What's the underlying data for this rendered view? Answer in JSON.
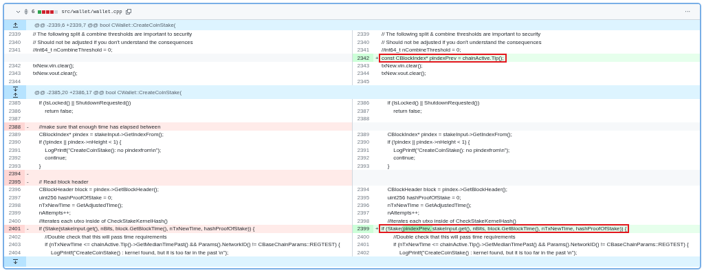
{
  "file_header": {
    "changes": "6",
    "diffstat": [
      {
        "color": "#2da44e"
      },
      {
        "color": "#cf222e"
      },
      {
        "color": "#cf222e"
      },
      {
        "color": "#cf222e"
      },
      {
        "color": "#d0d7de"
      }
    ],
    "path": "src/wallet/wallet.cpp",
    "menu": "···"
  },
  "hunks": [
    {
      "header": "@@ -2339,6 +2339,7 @@ bool CWallet::CreateCoinStake(",
      "expand_down": false,
      "rows": [
        {
          "left": {
            "kind": "context",
            "number": "2339",
            "code": "// The following split & combine thresholds are important to security"
          },
          "right": {
            "kind": "context",
            "number": "2339",
            "code": "// The following split & combine thresholds are important to security"
          }
        },
        {
          "left": {
            "kind": "context",
            "number": "2340",
            "code": "// Should not be adjusted if you don't understand the consequences"
          },
          "right": {
            "kind": "context",
            "number": "2340",
            "code": "// Should not be adjusted if you don't understand the consequences"
          }
        },
        {
          "left": {
            "kind": "context",
            "number": "2341",
            "code": "//int64_t nCombineThreshold = 0;"
          },
          "right": {
            "kind": "context",
            "number": "2341",
            "code": "//int64_t nCombineThreshold = 0;"
          }
        },
        {
          "left": {
            "kind": "empty"
          },
          "right": {
            "kind": "added",
            "number": "2342",
            "sign": "+",
            "boxed": true,
            "code": "const CBlockIndex* pindexPrev = chainActive.Tip();"
          }
        },
        {
          "left": {
            "kind": "context",
            "number": "2342",
            "code": "txNew.vin.clear();"
          },
          "right": {
            "kind": "context",
            "number": "2343",
            "code": "txNew.vin.clear();"
          }
        },
        {
          "left": {
            "kind": "context",
            "number": "2343",
            "code": "txNew.vout.clear();"
          },
          "right": {
            "kind": "context",
            "number": "2344",
            "code": "txNew.vout.clear();"
          }
        },
        {
          "left": {
            "kind": "context",
            "number": "2344"
          },
          "right": {
            "kind": "context",
            "number": "2345"
          }
        }
      ]
    },
    {
      "header": "@@ -2385,20 +2386,17 @@ bool CWallet::CreateCoinStake(",
      "expand_down": true,
      "rows": [
        {
          "left": {
            "kind": "context",
            "number": "2385",
            "code": "    if (IsLocked() || ShutdownRequested())"
          },
          "right": {
            "kind": "context",
            "number": "2386",
            "code": "    if (IsLocked() || ShutdownRequested())"
          }
        },
        {
          "left": {
            "kind": "context",
            "number": "2386",
            "code": "        return false;"
          },
          "right": {
            "kind": "context",
            "number": "2387",
            "code": "        return false;"
          }
        },
        {
          "left": {
            "kind": "context",
            "number": "2387"
          },
          "right": {
            "kind": "context",
            "number": "2388"
          }
        },
        {
          "left": {
            "kind": "deleted",
            "number": "2388",
            "sign": "-",
            "code": "    //make sure that enough time has elapsed between"
          },
          "right": {
            "kind": "empty"
          }
        },
        {
          "left": {
            "kind": "context",
            "number": "2389",
            "code": "    CBlockIndex* pindex = stakeInput->GetIndexFrom();"
          },
          "right": {
            "kind": "context",
            "number": "2389",
            "code": "    CBlockIndex* pindex = stakeInput->GetIndexFrom();"
          }
        },
        {
          "left": {
            "kind": "context",
            "number": "2390",
            "code": "    if (!pindex || pindex->nHeight < 1) {"
          },
          "right": {
            "kind": "context",
            "number": "2390",
            "code": "    if (!pindex || pindex->nHeight < 1) {"
          }
        },
        {
          "left": {
            "kind": "context",
            "number": "2391",
            "code": "        LogPrintf(\"CreateCoinStake(): no pindexfrom\\n\");"
          },
          "right": {
            "kind": "context",
            "number": "2391",
            "code": "        LogPrintf(\"CreateCoinStake(): no pindexfrom\\n\");"
          }
        },
        {
          "left": {
            "kind": "context",
            "number": "2392",
            "code": "        continue;"
          },
          "right": {
            "kind": "context",
            "number": "2392",
            "code": "        continue;"
          }
        },
        {
          "left": {
            "kind": "context",
            "number": "2393",
            "code": "    }"
          },
          "right": {
            "kind": "context",
            "number": "2393",
            "code": "    }"
          }
        },
        {
          "left": {
            "kind": "deleted",
            "number": "2394",
            "sign": "-"
          },
          "right": {
            "kind": "empty"
          }
        },
        {
          "left": {
            "kind": "deleted",
            "number": "2395",
            "sign": "-",
            "code": "    // Read block header"
          },
          "right": {
            "kind": "empty"
          }
        },
        {
          "left": {
            "kind": "context",
            "number": "2396",
            "code": "    CBlockHeader block = pindex->GetBlockHeader();"
          },
          "right": {
            "kind": "context",
            "number": "2394",
            "code": "    CBlockHeader block = pindex->GetBlockHeader();"
          }
        },
        {
          "left": {
            "kind": "context",
            "number": "2397",
            "code": "    uint256 hashProofOfStake = 0;"
          },
          "right": {
            "kind": "context",
            "number": "2395",
            "code": "    uint256 hashProofOfStake = 0;"
          }
        },
        {
          "left": {
            "kind": "context",
            "number": "2398",
            "code": "    nTxNewTime = GetAdjustedTime();"
          },
          "right": {
            "kind": "context",
            "number": "2396",
            "code": "    nTxNewTime = GetAdjustedTime();"
          }
        },
        {
          "left": {
            "kind": "context",
            "number": "2399",
            "code": "    nAttempts++;"
          },
          "right": {
            "kind": "context",
            "number": "2397",
            "code": "    nAttempts++;"
          }
        },
        {
          "left": {
            "kind": "context",
            "number": "2400",
            "code": "    //iterates each utxo inside of CheckStakeKernelHash()"
          },
          "right": {
            "kind": "context",
            "number": "2398",
            "code": "    //iterates each utxo inside of CheckStakeKernelHash()"
          }
        },
        {
          "left": {
            "kind": "deleted",
            "number": "2401",
            "sign": "-",
            "code": "    if (Stake(stakeInput.get(), nBits, block.GetBlockTime(), nTxNewTime, hashProofOfStake)) {"
          },
          "right": {
            "kind": "added",
            "number": "2399",
            "sign": "+",
            "boxed": true,
            "segments": [
              {
                "text": "if (Stake(",
                "changed": false
              },
              {
                "text": "pindexPrev, ",
                "changed": true
              },
              {
                "text": "stakeInput.get(), nBits, block.GetBlockTime(), nTxNewTime, hashProofOfStake)) {",
                "changed": false
              }
            ]
          }
        },
        {
          "left": {
            "kind": "context",
            "number": "2402",
            "code": "        //Double check that this will pass time requirements"
          },
          "right": {
            "kind": "context",
            "number": "2400",
            "code": "        //Double check that this will pass time requirements"
          }
        },
        {
          "left": {
            "kind": "context",
            "number": "2403",
            "code": "        if (nTxNewTime <= chainActive.Tip()->GetMedianTimePast() && Params().NetworkID() != CBaseChainParams::REGTEST) {"
          },
          "right": {
            "kind": "context",
            "number": "2401",
            "code": "        if (nTxNewTime <= chainActive.Tip()->GetMedianTimePast() && Params().NetworkID() != CBaseChainParams::REGTEST) {"
          }
        },
        {
          "left": {
            "kind": "context",
            "number": "2404",
            "code": "            LogPrintf(\"CreateCoinStake() : kernel found, but it is too far in the past \\n\");"
          },
          "right": {
            "kind": "context",
            "number": "2402",
            "code": "            LogPrintf(\"CreateCoinStake() : kernel found, but it is too far in the past \\n\");"
          }
        }
      ]
    }
  ],
  "footer": {
    "expand_down": true
  }
}
